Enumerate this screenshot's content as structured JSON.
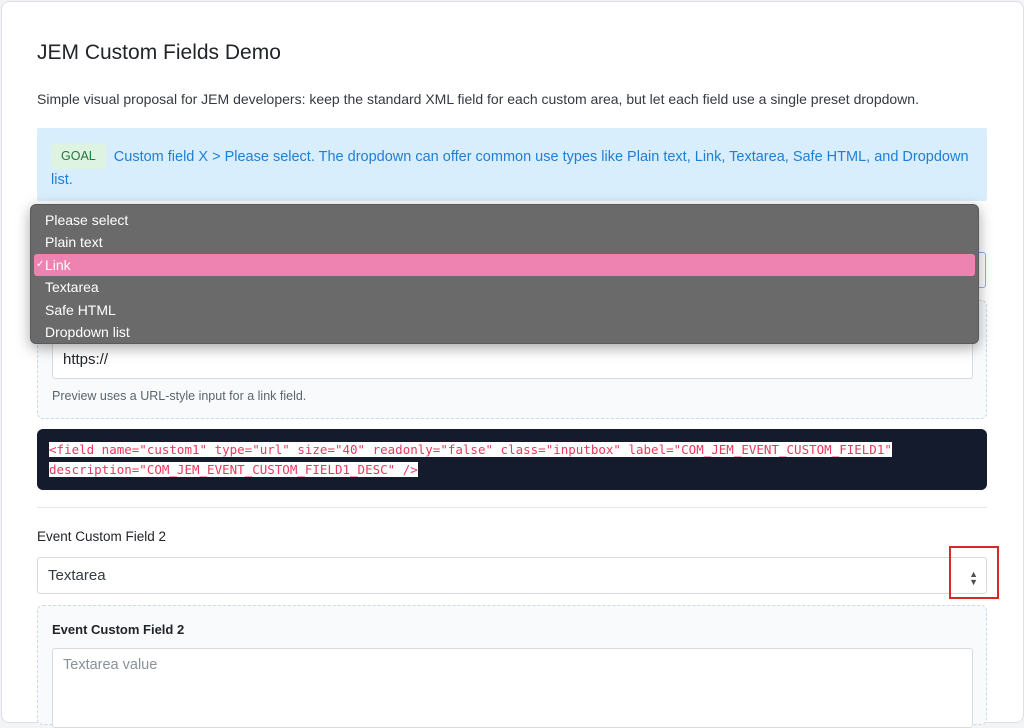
{
  "page": {
    "title": "JEM Custom Fields Demo",
    "subtitle": "Simple visual proposal for JEM developers: keep the standard XML field for each custom area, but let each field use a single preset dropdown."
  },
  "goal": {
    "badge": "GOAL",
    "text": "Custom field X > Please select. The dropdown can offer common use types like Plain text, Link, Textarea, Safe HTML, and Dropdown list."
  },
  "field1": {
    "preview_value": "https://",
    "help": "Preview uses a URL-style input for a link field.",
    "xml": "<field name=\"custom1\" type=\"url\" size=\"40\" readonly=\"false\" class=\"inputbox\" label=\"COM_JEM_EVENT_CUSTOM_FIELD1\" description=\"COM_JEM_EVENT_CUSTOM_FIELD1_DESC\" />",
    "xml_line1": "<field name=\"custom1\" type=\"url\" size=\"40\" readonly=\"false\" class=\"inputbox\" label=\"COM_JEM_EVENT_CUSTOM_FIELD1\"",
    "xml_line2": "description=\"COM_JEM_EVENT_CUSTOM_FIELD1_DESC\" />"
  },
  "dropdown": {
    "options": [
      "Please select",
      "Plain text",
      "Link",
      "Textarea",
      "Safe HTML",
      "Dropdown list"
    ],
    "selected": "Link",
    "check_mark": "✓",
    "highlight_color": "#ee82b0"
  },
  "field2": {
    "label": "Event Custom Field 2",
    "selected_value": "Textarea",
    "preview_label": "Event Custom Field 2",
    "textarea_placeholder": "Textarea value",
    "select_arrows": "▲▼"
  },
  "colors": {
    "goal_bg": "#d8eefc",
    "goal_text": "#1f7fd6",
    "code_bg": "#141b2d",
    "code_text": "#e8385c",
    "annotation_box": "#d62a2a"
  }
}
